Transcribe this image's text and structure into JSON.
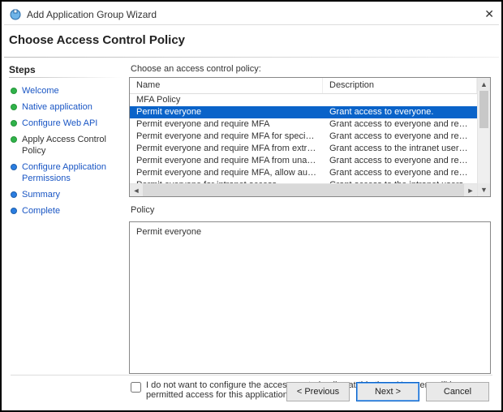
{
  "window": {
    "title": "Add Application Group Wizard",
    "close_glyph": "✕"
  },
  "header": {
    "title": "Choose Access Control Policy"
  },
  "sidebar": {
    "title": "Steps",
    "items": [
      {
        "label": "Welcome",
        "state": "done"
      },
      {
        "label": "Native application",
        "state": "done"
      },
      {
        "label": "Configure Web API",
        "state": "done"
      },
      {
        "label": "Apply Access Control Policy",
        "state": "current"
      },
      {
        "label": "Configure Application Permissions",
        "state": "todo"
      },
      {
        "label": "Summary",
        "state": "todo"
      },
      {
        "label": "Complete",
        "state": "todo"
      }
    ]
  },
  "main": {
    "choose_label": "Choose an access control policy:",
    "columns": {
      "name": "Name",
      "description": "Description"
    },
    "rows": [
      {
        "name": "MFA Policy",
        "description": ""
      },
      {
        "name": "Permit everyone",
        "description": "Grant access to everyone.",
        "selected": true
      },
      {
        "name": "Permit everyone and require MFA",
        "description": "Grant access to everyone and require MFA f..."
      },
      {
        "name": "Permit everyone and require MFA for specific group",
        "description": "Grant access to everyone and require MFA f..."
      },
      {
        "name": "Permit everyone and require MFA from extranet access",
        "description": "Grant access to the intranet users and requir..."
      },
      {
        "name": "Permit everyone and require MFA from unauthenticated ...",
        "description": "Grant access to everyone and require MFA f..."
      },
      {
        "name": "Permit everyone and require MFA, allow automatic devi...",
        "description": "Grant access to everyone and require MFA f..."
      },
      {
        "name": "Permit everyone for intranet access",
        "description": "Grant access to the intranet users."
      }
    ],
    "policy_label": "Policy",
    "policy_text": "Permit everyone",
    "optout_text": "I do not want to configure the access control policy at this time.  No users will be permitted access for this application."
  },
  "footer": {
    "previous": "< Previous",
    "next": "Next >",
    "cancel": "Cancel"
  }
}
